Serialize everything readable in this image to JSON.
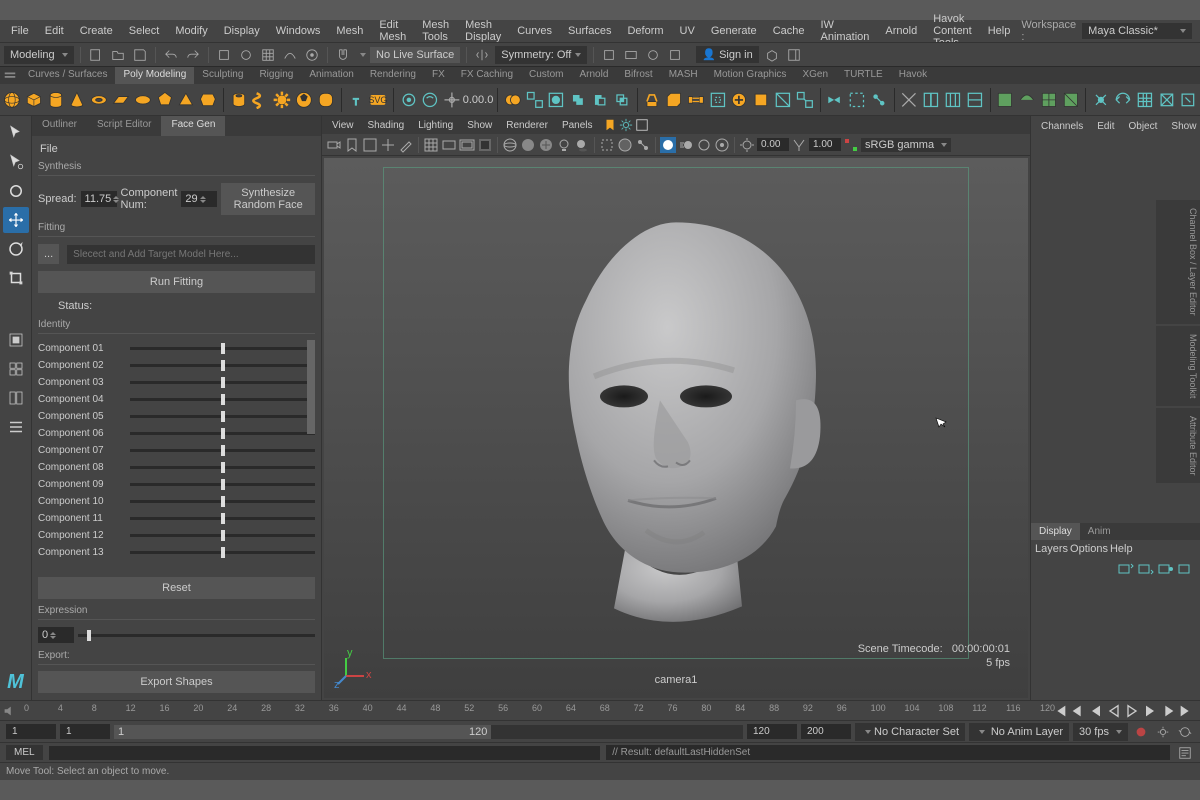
{
  "menubar": {
    "items": [
      "File",
      "Edit",
      "Create",
      "Select",
      "Modify",
      "Display",
      "Windows",
      "Mesh",
      "Edit Mesh",
      "Mesh Tools",
      "Mesh Display",
      "Curves",
      "Surfaces",
      "Deform",
      "UV",
      "Generate",
      "Cache",
      "IW Animation",
      "Arnold",
      "Havok Content Tools",
      "Help"
    ],
    "workspace_label": "Workspace :",
    "workspace_value": "Maya Classic*",
    "signin": "Sign in"
  },
  "status": {
    "context": "Modeling",
    "nolive": "No Live Surface",
    "symmetry": "Symmetry: Off"
  },
  "shelf": {
    "tabs": [
      "Curves / Surfaces",
      "Poly Modeling",
      "Sculpting",
      "Rigging",
      "Animation",
      "Rendering",
      "FX",
      "FX Caching",
      "Custom",
      "Arnold",
      "Bifrost",
      "MASH",
      "Motion Graphics",
      "XGen",
      "TURTLE",
      "Havok"
    ],
    "active": "Poly Modeling"
  },
  "panel": {
    "tabs": [
      "Outliner",
      "Script Editor",
      "Face Gen"
    ],
    "active": "Face Gen",
    "file": "File",
    "synthesis": {
      "title": "Synthesis",
      "spread_label": "Spread:",
      "spread": "11.75",
      "compnum_label": "Component Num:",
      "compnum": "29",
      "btn": "Synthesize Random Face"
    },
    "fitting": {
      "title": "Fitting",
      "placeholder": "Slecect and Add Target Model Here...",
      "dots": "...",
      "run": "Run Fitting",
      "status_label": "Status:"
    },
    "identity": {
      "title": "Identity",
      "components": [
        "Component 01",
        "Component 02",
        "Component 03",
        "Component 04",
        "Component 05",
        "Component 06",
        "Component 07",
        "Component 08",
        "Component 09",
        "Component 10",
        "Component 11",
        "Component 12",
        "Component 13"
      ],
      "reset": "Reset"
    },
    "expression": {
      "title": "Expression",
      "value": "0"
    },
    "export": {
      "title": "Export:",
      "btn": "Export Shapes"
    }
  },
  "viewport": {
    "menu": [
      "View",
      "Shading",
      "Lighting",
      "Show",
      "Renderer",
      "Panels"
    ],
    "exposure_label": "",
    "exposure": "0.00",
    "gamma": "1.00",
    "colorspace": "sRGB gamma",
    "camera": "camera1",
    "timecode_label": "Scene Timecode:",
    "timecode": "00:00:00:01",
    "fps": "5 fps"
  },
  "right": {
    "menu": [
      "Channels",
      "Edit",
      "Object",
      "Show"
    ],
    "tabs2": [
      "Display",
      "Anim"
    ],
    "layermenu": [
      "Layers",
      "Options",
      "Help"
    ]
  },
  "sidetabs": [
    "Channel Box / Layer Editor",
    "Modeling Toolkit",
    "Attribute Editor"
  ],
  "timeline": {
    "ticks": [
      0,
      4,
      8,
      12,
      16,
      20,
      24,
      28,
      32,
      36,
      40,
      44,
      48,
      52,
      56,
      60,
      64,
      68,
      72,
      76,
      80,
      84,
      88,
      92,
      96,
      100,
      104,
      108,
      112,
      116,
      120
    ]
  },
  "range": {
    "start1": "1",
    "start2": "1",
    "end1": "120",
    "end2": "200",
    "slider_start": "1",
    "slider_end": "120",
    "charset": "No Character Set",
    "animlayer": "No Anim Layer",
    "fps": "30 fps"
  },
  "mel": {
    "label": "MEL",
    "result": "// Result: defaultLastHiddenSet"
  },
  "help": "Move Tool: Select an object to move."
}
